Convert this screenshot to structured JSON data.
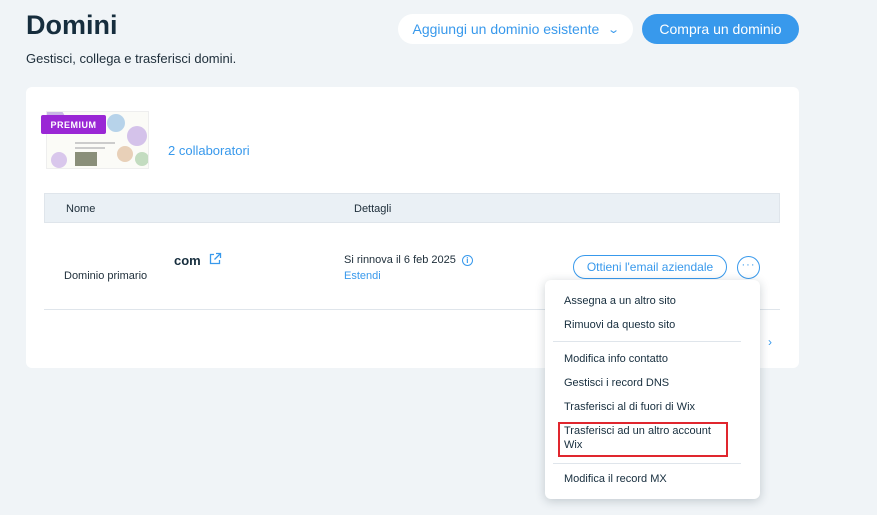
{
  "header": {
    "title": "Domini",
    "subtitle": "Gestisci, collega e trasferisci domini.",
    "add_existing_label": "Aggiungi un dominio esistente",
    "buy_label": "Compra un dominio"
  },
  "site": {
    "badge": "PREMIUM",
    "collaborators": "2 collaboratori"
  },
  "table": {
    "columns": [
      "Nome",
      "Dettagli"
    ],
    "row": {
      "domain": "com",
      "domain_type": "Dominio primario",
      "renewal": "Si rinnova il 6 feb 2025",
      "extend": "Estendi",
      "email_button": "Ottieni l'email aziendale",
      "more_button": "···"
    }
  },
  "pager_icon": "›",
  "menu": {
    "items": [
      "Assegna a un altro sito",
      "Rimuovi da questo sito",
      "Modifica info contatto",
      "Gestisci i record DNS",
      "Trasferisci al di fuori di Wix",
      "Trasferisci ad un altro account",
      "Wix",
      "Modifica il record MX"
    ],
    "highlighted_item": "Trasferisci ad un altro account Wix"
  },
  "colors": {
    "accent": "#3899ec",
    "premium": "#9a27d5",
    "highlight_border": "#e0262e",
    "background": "#f0f4f7"
  }
}
